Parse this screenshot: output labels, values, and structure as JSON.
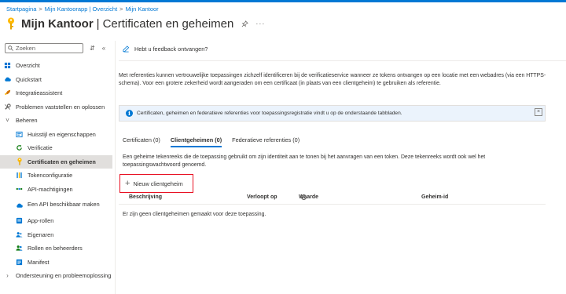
{
  "breadcrumb": [
    {
      "label": "Startpagina"
    },
    {
      "label": "Mijn Kantoorapp | Overzicht"
    },
    {
      "label": "Mijn Kantoor"
    }
  ],
  "header": {
    "app_name": "Mijn Kantoor",
    "separator": "|",
    "page_title": "Certificaten en geheimen",
    "more": "···"
  },
  "sidebar": {
    "search_placeholder": "Zoeken",
    "collapse": "«",
    "items": [
      {
        "label": "Overzicht",
        "icon": "grid-icon",
        "color": "#0078d4"
      },
      {
        "label": "Quickstart",
        "icon": "cloud-icon",
        "color": "#0078d4"
      },
      {
        "label": "Integratieassistent",
        "icon": "rocket-icon",
        "color": "#d47500"
      },
      {
        "label": "Problemen vaststellen en oplossen",
        "icon": "wrench-icon",
        "color": "#605e5c"
      },
      {
        "label": "Beheren",
        "chevron": "expanded"
      },
      {
        "label": "Huisstijl en eigenschappen",
        "icon": "branding-icon",
        "color": "#0078d4",
        "child": true
      },
      {
        "label": "Verificatie",
        "icon": "refresh-icon",
        "color": "#107c10",
        "child": true
      },
      {
        "label": "Certificaten en geheimen",
        "icon": "key-icon",
        "color": "#ffb900",
        "child": true,
        "active": true
      },
      {
        "label": "Tokenconfiguratie",
        "icon": "token-icon",
        "color": "#0078d4",
        "child": true
      },
      {
        "label": "API-machtigingen",
        "icon": "api-permissions-icon",
        "color": "#107c10",
        "child": true
      },
      {
        "label": "Een API beschikbaar maken",
        "icon": "cloud-api-icon",
        "color": "#0078d4",
        "child": true,
        "tall": true
      },
      {
        "label": "App-rollen",
        "icon": "app-roles-icon",
        "color": "#0078d4",
        "child": true
      },
      {
        "label": "Eigenaren",
        "icon": "users-icon",
        "color": "#0078d4",
        "child": true
      },
      {
        "label": "Rollen en beheerders",
        "icon": "roles-admins-icon",
        "color": "#107c10",
        "child": true
      },
      {
        "label": "Manifest",
        "icon": "manifest-icon",
        "color": "#0078d4",
        "child": true
      },
      {
        "label": "Ondersteuning en probleemoplossing",
        "chevron": "collapsed"
      }
    ]
  },
  "main": {
    "feedback": "Hebt u feedback ontvangen?",
    "intro": "Met referenties kunnen vertrouwelijke toepassingen zichzelf identificeren bij de verificatieservice wanneer ze tokens ontvangen op een locatie met een webadres (via een HTTPS-schema). Voor een grotere zekerheid wordt aangeraden om een certificaat (in plaats van een clientgeheim) te gebruiken als referentie.",
    "info": "Certificaten, geheimen en federatieve referenties voor toepassingsregistratie vindt u op de onderstaande tabbladen.",
    "info_close": "×",
    "tabs": [
      {
        "label": "Certificaten (0)"
      },
      {
        "label": "Clientgeheimen (0)",
        "active": true
      },
      {
        "label": "Federatieve referenties (0)"
      }
    ],
    "tab_description": "Een geheime tekenreeks die de toepassing gebruikt om zijn identiteit aan te tonen bij het aanvragen van een token. Deze tekenreeks wordt ook wel het toepassingswachtwoord genoemd.",
    "new_button": "Nieuw clientgeheim",
    "table": {
      "columns": [
        "Beschrijving",
        "Verloopt op",
        "Waarde",
        "Geheim-id"
      ],
      "empty_text": "Er zijn geen clientgeheimen gemaakt voor deze toepassing."
    }
  },
  "colors": {
    "accent": "#0078d4",
    "highlight_border": "#e81123",
    "active_bg": "#e1dfdd",
    "info_bg": "#ebf3fc"
  }
}
